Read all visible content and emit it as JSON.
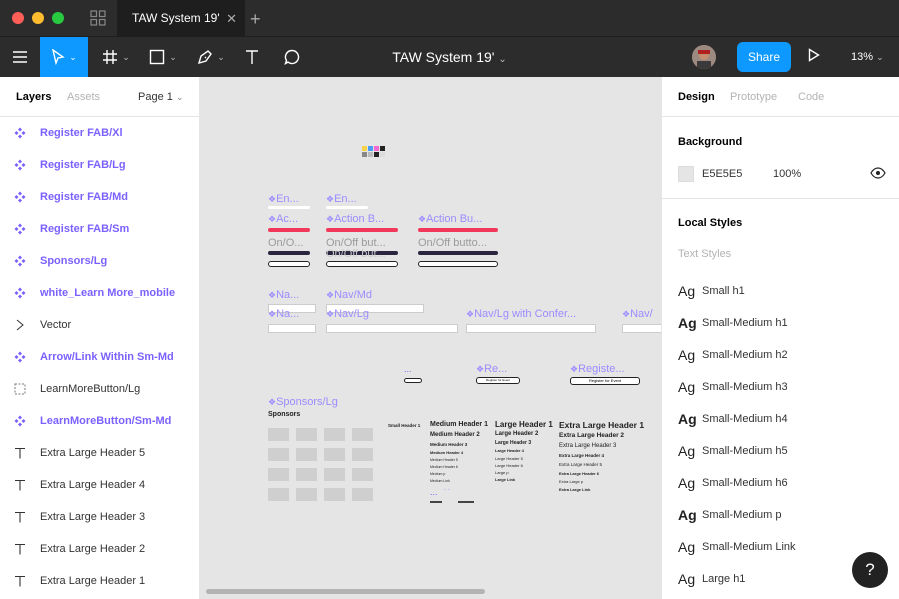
{
  "window": {
    "tab_title": "TAW System 19'",
    "tab_close": "✕",
    "new_tab": "+"
  },
  "toolbar": {
    "file_title": "TAW System 19'",
    "share_label": "Share",
    "zoom": "13%",
    "caret": "⌄"
  },
  "left_panel": {
    "tabs": {
      "layers": "Layers",
      "assets": "Assets",
      "page": "Page 1"
    },
    "layers": [
      {
        "label": "Register FAB/Xl",
        "type": "component"
      },
      {
        "label": "Register FAB/Lg",
        "type": "component"
      },
      {
        "label": "Register FAB/Md",
        "type": "component"
      },
      {
        "label": "Register FAB/Sm",
        "type": "component"
      },
      {
        "label": "Sponsors/Lg",
        "type": "component"
      },
      {
        "label": "white_Learn More_mobile",
        "type": "component"
      },
      {
        "label": "Vector",
        "type": "vector"
      },
      {
        "label": "Arrow/Link Within Sm-Md",
        "type": "component"
      },
      {
        "label": "LearnMoreButton/Lg",
        "type": "frame"
      },
      {
        "label": "LearnMoreButton/Sm-Md",
        "type": "component"
      },
      {
        "label": "Extra Large Header 5",
        "type": "text"
      },
      {
        "label": "Extra Large Header 4",
        "type": "text"
      },
      {
        "label": "Extra Large Header 3",
        "type": "text"
      },
      {
        "label": "Extra Large Header 2",
        "type": "text"
      },
      {
        "label": "Extra Large Header 1",
        "type": "text"
      }
    ]
  },
  "canvas": {
    "labels": {
      "en1": "En...",
      "en2": "En...",
      "ac": "Ac...",
      "action1": "Action B...",
      "action2": "Action Bu...",
      "onoff1": "On/O...",
      "onoff2": "On/Off but...",
      "onoff3": "On/Off butto...",
      "onoff_ghost": "On/Off but...",
      "na1": "Na...",
      "navmd": "Nav/Md",
      "na2": "Na...",
      "navlg": "Nav/Lg",
      "navconf": "Nav/Lg with Confer...",
      "navtrunc": "Nav/",
      "dots": "...",
      "re": "Re...",
      "registe": "Registe...",
      "sponsors_lbl": "Sponsors/Lg",
      "sponsors_title": "Sponsors",
      "register_btn1": "Register for Event",
      "register_btn2": "Register for Event",
      "dots2": "...",
      "dots3": ". ."
    },
    "headers": {
      "small_h1": "Small Header 1",
      "medium": [
        "Medium Header 1",
        "Medium Header 2",
        "Medium Header 3",
        "Medium Header 4",
        "Medium Header 5",
        "Medium Header 6",
        "Medium p",
        "Medium Link"
      ],
      "large": [
        "Large Header 1",
        "Large Header 2",
        "Large Header 3",
        "Large Header 4",
        "Large Header 5",
        "Large Header 6",
        "Large p",
        "Large Link"
      ],
      "xlarge": [
        "Extra Large Header 1",
        "Extra Large Header 2",
        "Extra Large Header 3",
        "Extra Large Header 4",
        "Extra Large Header 5",
        "Extra Large Header 6",
        "Extra Large p",
        "Extra Large Link"
      ]
    },
    "colors": {
      "pink": "#f2385a",
      "dark": "#2b2540",
      "swatches": [
        "#f5d547",
        "#4b9cf5",
        "#f26ad1",
        "#222222",
        "#888888",
        "#bbbbbb",
        "#222222",
        "#dddddd"
      ]
    }
  },
  "right_panel": {
    "tabs": {
      "design": "Design",
      "prototype": "Prototype",
      "code": "Code"
    },
    "background_title": "Background",
    "bg_hex": "E5E5E5",
    "bg_opacity": "100%",
    "local_styles_title": "Local Styles",
    "text_styles_label": "Text Styles",
    "ag": "Ag",
    "styles": [
      "Small h1",
      "Small-Medium h1",
      "Small-Medium h2",
      "Small-Medium h3",
      "Small-Medium h4",
      "Small-Medium h5",
      "Small-Medium h6",
      "Small-Medium p",
      "Small-Medium Link",
      "Large h1"
    ]
  },
  "help_label": "?"
}
